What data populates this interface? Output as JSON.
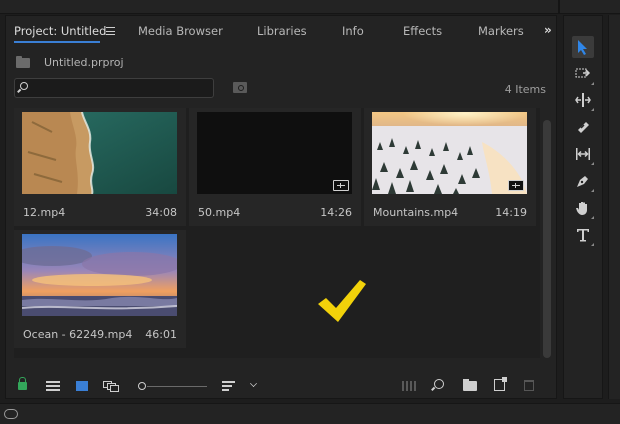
{
  "tabs": [
    {
      "label": "Project: Untitled",
      "active": true
    },
    {
      "label": "Media Browser"
    },
    {
      "label": "Libraries"
    },
    {
      "label": "Info"
    },
    {
      "label": "Effects"
    },
    {
      "label": "Markers"
    }
  ],
  "overflow_label": "»",
  "project": {
    "file_name": "Untitled.prproj"
  },
  "search": {
    "value": "",
    "placeholder": ""
  },
  "items_count": "4 Items",
  "clips": [
    {
      "name": "12.mp4",
      "duration": "34:08",
      "thumbnail": "coastal-cliffs-aerial",
      "has_audio_badge": false
    },
    {
      "name": "50.mp4",
      "duration": "14:26",
      "thumbnail": "black-frame",
      "has_audio_badge": true
    },
    {
      "name": "Mountains.mp4",
      "duration": "14:19",
      "thumbnail": "snowy-forest-sunset",
      "has_audio_badge": true
    },
    {
      "name": "Ocean - 62249.mp4",
      "duration": "46:01",
      "thumbnail": "ocean-sunset-clouds",
      "has_audio_badge": false
    }
  ],
  "overlay": {
    "icon": "checkmark-icon",
    "color": "#f2d20a"
  },
  "bottom_bar": {
    "icons": [
      "lock-icon",
      "list-view-icon",
      "icon-view-icon",
      "freeform-view-icon",
      "zoom-slider",
      "sort-icon",
      "sort-dropdown-icon",
      "automate-to-sequence-icon",
      "find-icon",
      "new-bin-icon",
      "new-item-icon",
      "clear-trash-icon"
    ],
    "lock_color": "#33a65a",
    "active_view_color": "#3a7fd5"
  },
  "tools": [
    "selection-tool",
    "track-select-forward-tool",
    "ripple-edit-tool",
    "razor-tool",
    "slip-tool",
    "pen-tool",
    "hand-tool",
    "type-tool"
  ],
  "accent_color": "#3a7fd5"
}
